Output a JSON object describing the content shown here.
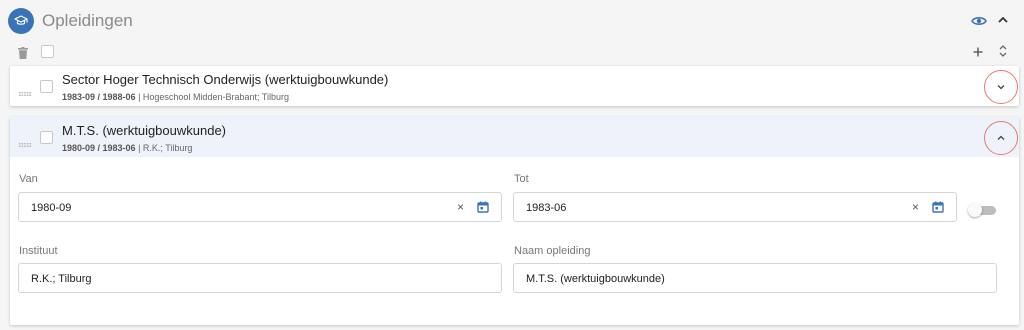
{
  "header": {
    "title": "Opleidingen",
    "icon": "graduation-cap-icon",
    "accent_color": "#3b73b9"
  },
  "items": [
    {
      "title": "Sector Hoger Technisch Onderwijs (werktuigbouwkunde)",
      "dates": "1983-09 / 1988-06",
      "institute": "Hogeschool Midden-Brabant; Tilburg",
      "expanded": false
    },
    {
      "title": "M.T.S. (werktuigbouwkunde)",
      "dates": "1980-09 / 1983-06",
      "institute": "R.K.; Tilburg",
      "expanded": true
    }
  ],
  "form": {
    "van_label": "Van",
    "van_value": "1980-09",
    "tot_label": "Tot",
    "tot_value": "1983-06",
    "instituut_label": "Instituut",
    "instituut_value": "R.K.; Tilburg",
    "naam_label": "Naam opleiding",
    "naam_value": "M.T.S. (werktuigbouwkunde)",
    "clear_symbol": "×",
    "switch_on": false
  }
}
